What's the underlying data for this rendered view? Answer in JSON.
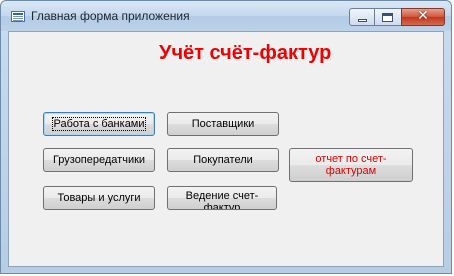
{
  "window": {
    "title": "Главная форма приложения",
    "close_glyph": "✕"
  },
  "heading": "Учёт счёт-фактур",
  "buttons": {
    "banks": "Работа с банками",
    "suppliers": "Поставщики",
    "shippers": "Грузопередатчики",
    "customers": "Покупатели",
    "invoice_report": "отчет по счет-фактурам",
    "goods_services": "Товары и услуги",
    "invoice_journal": "Ведение счет-фактур"
  },
  "colors": {
    "heading": "#f00000",
    "report_button_text": "#e00000"
  }
}
